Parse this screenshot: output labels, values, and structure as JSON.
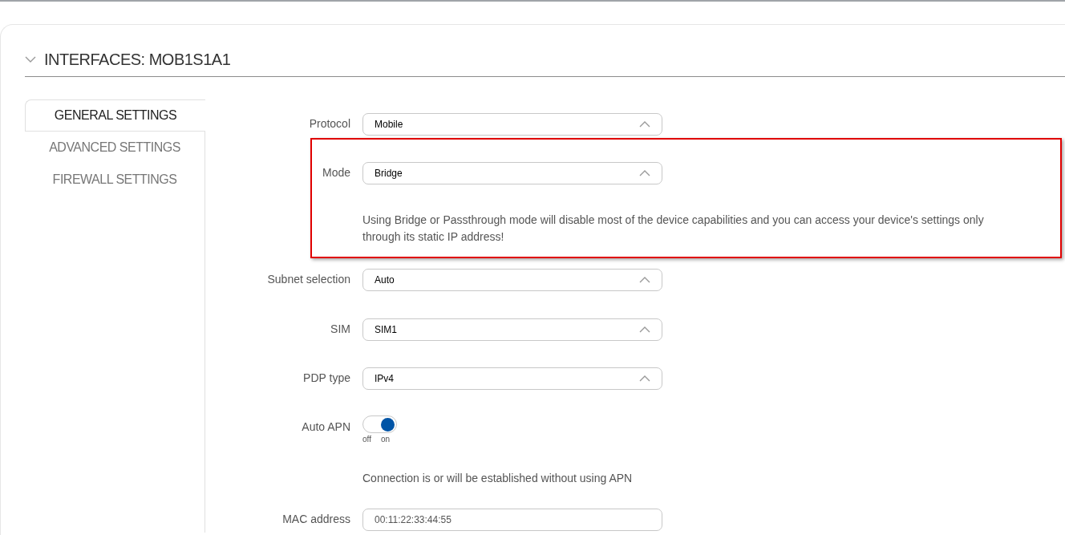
{
  "section": {
    "title": "INTERFACES: MOB1S1A1",
    "expanded": true
  },
  "tabs": [
    {
      "label": "GENERAL SETTINGS",
      "selected": true
    },
    {
      "label": "ADVANCED SETTINGS",
      "selected": false
    },
    {
      "label": "FIREWALL SETTINGS",
      "selected": false
    }
  ],
  "form": [
    {
      "kind": "select",
      "label": "Protocol",
      "value": "Mobile"
    },
    {
      "kind": "highlight",
      "rows": [
        {
          "kind": "select",
          "label": "Mode",
          "value": "Bridge"
        },
        {
          "kind": "note",
          "text": "Using Bridge or Passthrough mode will disable most of the device capabilities and you can access your device's settings only through its static IP address!"
        }
      ]
    },
    {
      "kind": "select",
      "label": "Subnet selection",
      "value": "Auto"
    },
    {
      "kind": "select",
      "label": "SIM",
      "value": "SIM1"
    },
    {
      "kind": "select",
      "label": "PDP type",
      "value": "IPv4"
    },
    {
      "kind": "toggle",
      "label": "Auto APN",
      "on": true,
      "off_label": "off",
      "on_label": "on"
    },
    {
      "kind": "note",
      "text": "Connection is or will be established without using APN"
    },
    {
      "kind": "input",
      "label": "MAC address",
      "value": "00:11:22:33:44:55"
    }
  ]
}
